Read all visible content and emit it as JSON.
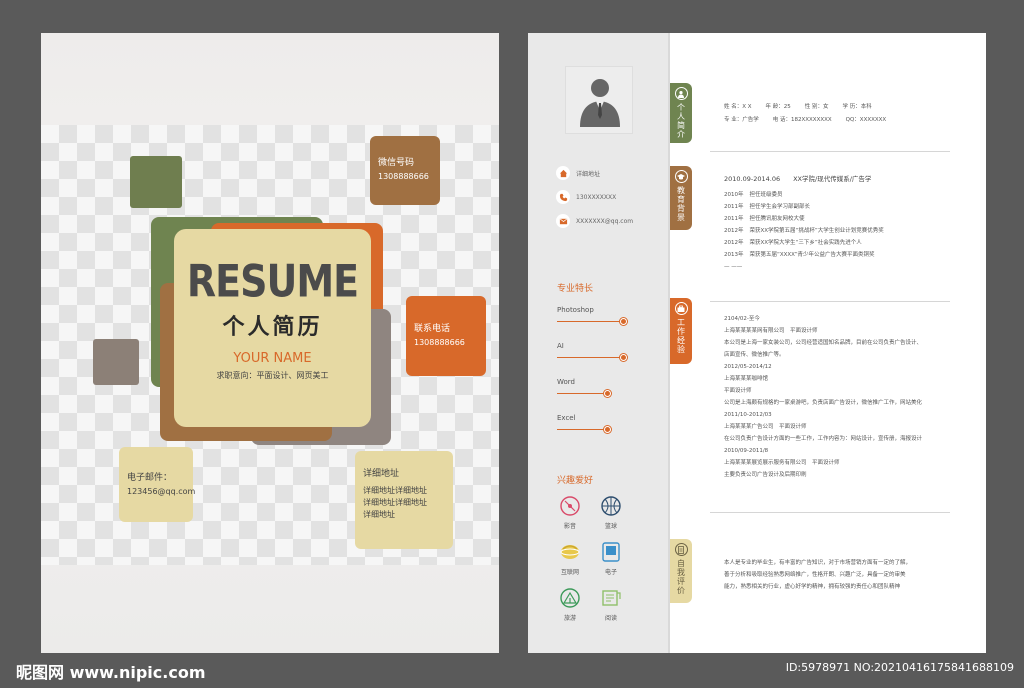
{
  "cover": {
    "title": "RESUME",
    "title_cn": "个人简历",
    "name": "YOUR NAME",
    "intent": "求职意向：平面设计、网页美工",
    "wechat": {
      "label": "微信号码",
      "value": "1308888666"
    },
    "phone": {
      "label": "联系电话",
      "value": "1308888666"
    },
    "email": {
      "label": "电子邮件：",
      "value": "123456@qq.com"
    },
    "address": {
      "label": "详细地址",
      "lines": [
        "详细地址详细地址",
        "详细地址详细地址",
        "详细地址"
      ]
    }
  },
  "sidebar": {
    "contacts": [
      {
        "icon": "home-icon",
        "text": "详细地址"
      },
      {
        "icon": "phone-icon",
        "text": "130XXXXXXX"
      },
      {
        "icon": "mail-icon",
        "text": "XXXXXXX@qq.com"
      }
    ],
    "skills_heading": "专业特长",
    "skills": [
      {
        "name": "Photoshop",
        "level": 0.9
      },
      {
        "name": "AI",
        "level": 0.9
      },
      {
        "name": "Word",
        "level": 0.68
      },
      {
        "name": "Excel",
        "level": 0.68
      }
    ],
    "hobbies_heading": "兴趣爱好",
    "hobbies": [
      {
        "icon": "film-disc-icon",
        "label": "影音"
      },
      {
        "icon": "basketball-icon",
        "label": "篮球"
      },
      {
        "icon": "internet-icon",
        "label": "互联网"
      },
      {
        "icon": "electronics-icon",
        "label": "电子"
      },
      {
        "icon": "travel-tent-icon",
        "label": "旅游"
      },
      {
        "icon": "reading-icon",
        "label": "阅读"
      }
    ]
  },
  "tabs": {
    "profile": "个人简介",
    "education": "教育背景",
    "work": "工作经验",
    "evaluation": "自我评价"
  },
  "profile": {
    "row1": [
      "姓 名：X X",
      "年 龄：25",
      "性 别：女",
      "学 历：本科"
    ],
    "row2": [
      "专 业：广告学",
      "电 话：182XXXXXXXX",
      "QQ：XXXXXXX"
    ]
  },
  "education": {
    "head": "2010.09-2014.06　　XX学院/现代传媒系/广告学",
    "items": [
      {
        "year": "2010年",
        "text": "担任班级委员"
      },
      {
        "year": "2011年",
        "text": "担任学生会学习部副部长"
      },
      {
        "year": "2011年",
        "text": "担任腾讯朋友网校大使"
      },
      {
        "year": "2012年",
        "text": "荣获XX学院第五届“挑战杯”大学生创业计划竞赛优秀奖"
      },
      {
        "year": "2012年",
        "text": "荣获XX学院大学生“三下乡”社会实践先进个人"
      },
      {
        "year": "2013年",
        "text": "荣获第五届“XXXX”青少年公益广告大赛平面类铜奖"
      }
    ],
    "more": "— ——"
  },
  "work": [
    "2104/02-至今",
    "上海某某某某网有限公司　平面设计师",
    "本公司是上海一家女装公司，公司经营适国知名品牌，目前在公司负责广告设计、",
    "店面宣传、微信推广等。",
    "2012/05-2014/12",
    "上海某某某咖啡馆",
    "平面设计师",
    "公司是上海颇有规格的一家桌游吧，负责店面广告设计，微信推广工作，网站美化",
    "2011/10-2012/03",
    "上海某某某广告公司　平面设计师",
    "在公司负责广告设计方面的一些工作，工作内容为：网站设计，宣传册，海报设计",
    "2010/09-2011/8",
    "上海某某某展览展示服务有限公司　平面设计师",
    "主要负责公司广告设计及后期印刷"
  ],
  "evaluation": [
    "本人是专业的毕业生，有丰富的广告知识，对于市场营销方面有一定的了解，",
    "善于分析和吸取经验熟悉网络推广，性格开朗、兴趣广泛，具备一定的审美",
    "能力，熟悉相关的行业，虚心好学的精神，拥有较强的责任心和团队精神"
  ],
  "watermark": {
    "left": "昵图网 www.nipic.com",
    "right": "ID:5978971 NO:20210416175841688109"
  },
  "colors": {
    "green": "#6f8450",
    "brown": "#a07042",
    "orange": "#d8692a",
    "cream": "#e6d9a3",
    "grey": "#8f8580",
    "background": "#5a5a5a"
  }
}
